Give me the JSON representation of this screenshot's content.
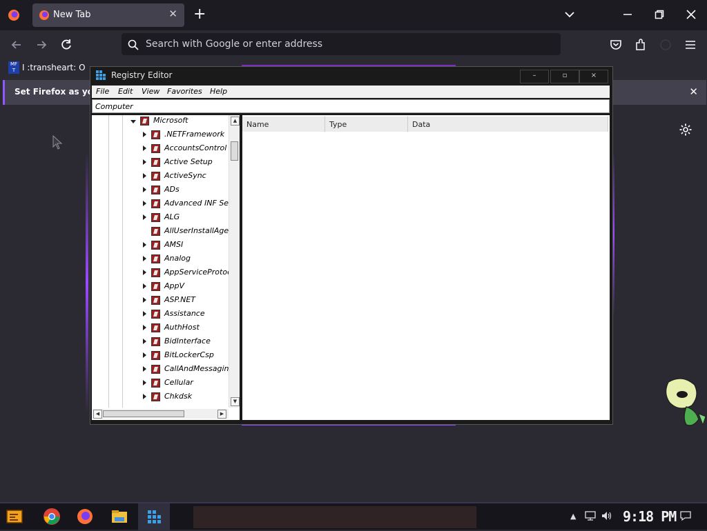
{
  "browser": {
    "tab_title": "New Tab",
    "tab_close": "✕",
    "new_tab_symbol": "+",
    "url_placeholder": "Search with Google or enter address",
    "bookmark_label": "I :transheart: O",
    "bookmark_icon_text": "MF T",
    "notification_text": "Set Firefox as yo",
    "notification_close": "✕"
  },
  "registry": {
    "title": "Registry Editor",
    "menu": [
      "File",
      "Edit",
      "View",
      "Favorites",
      "Help"
    ],
    "address": "Computer",
    "tree_root": "Microsoft",
    "tree_items": [
      ".NETFramework",
      "AccountsControl",
      "Active Setup",
      "ActiveSync",
      "ADs",
      "Advanced INF Se",
      "ALG",
      "AllUserInstallAge",
      "AMSI",
      "Analog",
      "AppServiceProtoc",
      "AppV",
      "ASP.NET",
      "Assistance",
      "AuthHost",
      "BidInterface",
      "BitLockerCsp",
      "CallAndMessaging",
      "Cellular",
      "Chkdsk"
    ],
    "columns": [
      "Name",
      "Type",
      "Data"
    ]
  },
  "taskbar": {
    "clock": "9:18 PM"
  },
  "colors": {
    "accent": "#9059ff",
    "tree_folder": "#a02020"
  }
}
